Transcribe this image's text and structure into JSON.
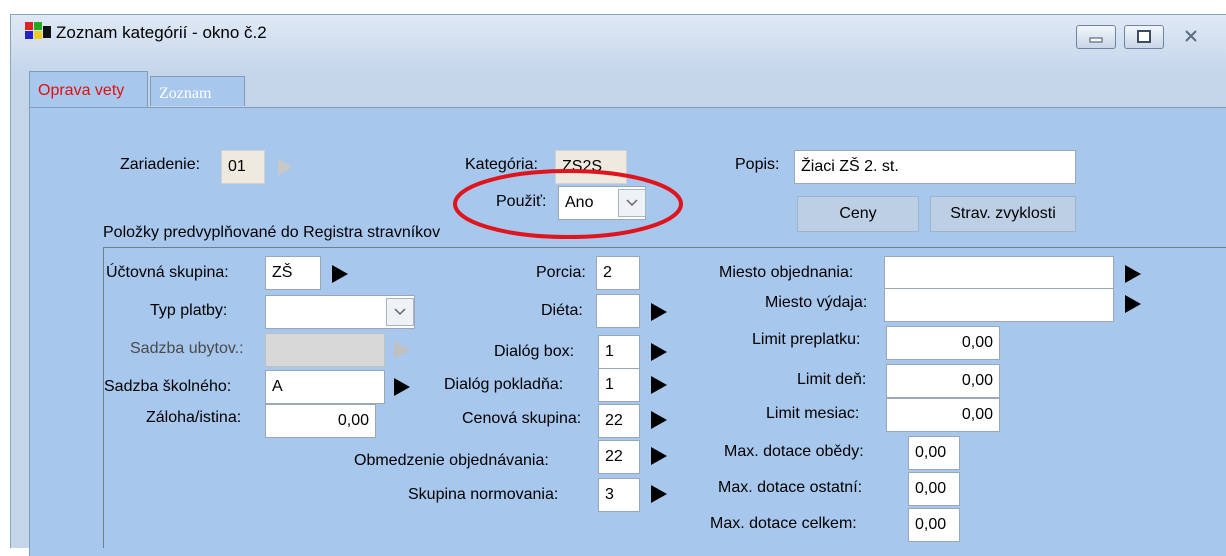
{
  "window": {
    "title": "Zoznam kategórií - okno č.2",
    "controls": [
      "minimize-icon",
      "maximize-icon",
      "close-icon"
    ]
  },
  "tabs": [
    {
      "label": "Oprava vety",
      "active": true
    },
    {
      "label": "Zoznam",
      "active": false
    }
  ],
  "header": {
    "zariadenie_label": "Zariadenie:",
    "zariadenie_value": "01",
    "kategoria_label": "Kategória:",
    "kategoria_value": "ZS2S",
    "popis_label": "Popis:",
    "popis_value": "Žiaci ZŠ 2. st.",
    "pouzit_label": "Použiť:",
    "pouzit_value": "Ano",
    "ceny_button": "Ceny",
    "zvyklosti_button": "Strav. zvyklosti"
  },
  "group": {
    "title": "Položky predvyplňované do Registra stravníkov"
  },
  "left": {
    "uctovna_label": "Účtovná skupina:",
    "uctovna_value": "ZŠ",
    "typ_platby_label": "Typ platby:",
    "typ_platby_value": "",
    "sadzba_ubyt_label": "Sadzba ubytov.:",
    "sadzba_skol_label": "Sadzba školného:",
    "sadzba_skol_value": "A",
    "zaloha_label": "Záloha/istina:",
    "zaloha_value": "0,00"
  },
  "middle": {
    "porcia_label": "Porcia:",
    "porcia_value": "2",
    "dieta_label": "Diéta:",
    "dieta_value": "",
    "dialog_box_label": "Dialóg box:",
    "dialog_box_value": "1",
    "dialog_pokl_label": "Dialóg pokladňa:",
    "dialog_pokl_value": "1",
    "cenova_label": "Cenová skupina:",
    "cenova_value": "22",
    "obmedzenie_label": "Obmedzenie objednávania:",
    "obmedzenie_value": "22",
    "normovania_label": "Skupina normovania:",
    "normovania_value": "3"
  },
  "right": {
    "miesto_obj_label": "Miesto objednania:",
    "miesto_obj_value": "",
    "miesto_vyd_label": "Miesto výdaja:",
    "miesto_vyd_value": "",
    "limit_prepl_label": "Limit preplatku:",
    "limit_prepl_value": "0,00",
    "limit_den_label": "Limit deň:",
    "limit_den_value": "0,00",
    "limit_mes_label": "Limit mesiac:",
    "limit_mes_value": "0,00",
    "max_obedy_label": "Max. dotace obědy:",
    "max_obedy_value": "0,00",
    "max_ostatni_label": "Max. dotace ostatní:",
    "max_ostatni_value": "0,00",
    "max_celkem_label": "Max. dotace celkem:",
    "max_celkem_value": "0,00"
  },
  "colors": {
    "highlight_ellipse": "#e0141c",
    "active_tab_text": "#e01010",
    "panel": "#a7c7ed"
  }
}
